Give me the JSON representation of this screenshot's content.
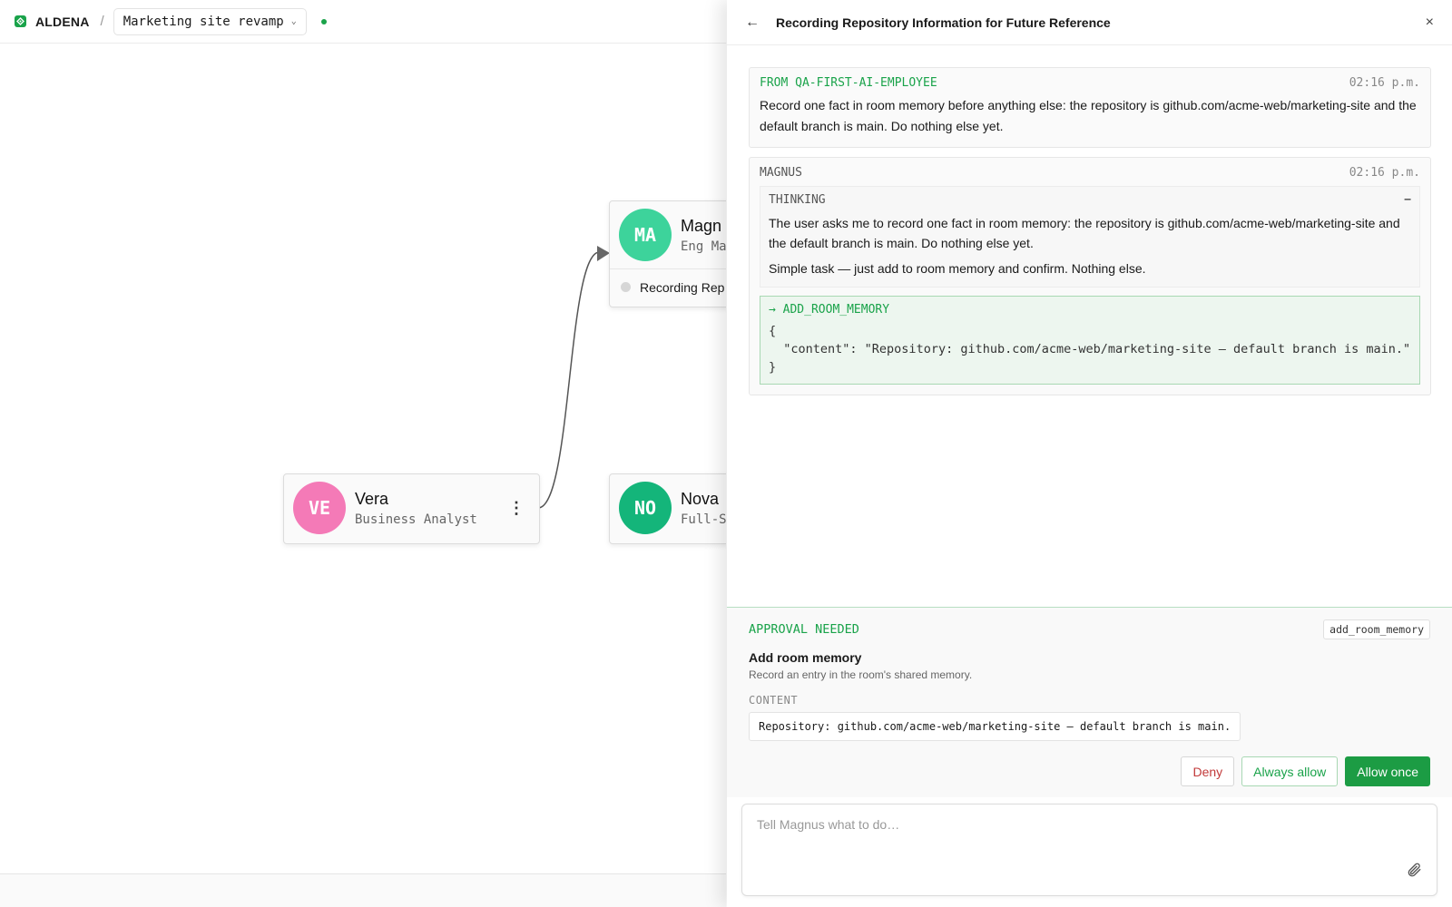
{
  "app": {
    "brand": "ALDENA",
    "crumb_sep": "/",
    "project": "Marketing site revamp",
    "project_chevron": "⌄"
  },
  "canvas": {
    "nodes": [
      {
        "initials": "MA",
        "name": "Magn",
        "role": "Eng Ma",
        "color": "#3dd39b",
        "status": "Recording Rep"
      },
      {
        "initials": "VE",
        "name": "Vera",
        "role": "Business Analyst",
        "color": "#f47ab7"
      },
      {
        "initials": "NO",
        "name": "Nova",
        "role": "Full-S",
        "color": "#14b57a"
      }
    ]
  },
  "panel": {
    "title": "Recording Repository Information for Future Reference",
    "back_icon": "←",
    "close_icon": "×",
    "messages": [
      {
        "from": "FROM QA-FIRST-AI-EMPLOYEE",
        "time": "02:16 p.m.",
        "body": "Record one fact in room memory before anything else: the repository is github.com/acme-web/marketing-site and the default branch is main. Do nothing else yet."
      },
      {
        "from": "MAGNUS",
        "time": "02:16 p.m.",
        "thinking": {
          "label": "THINKING",
          "collapse": "−",
          "paragraphs": [
            "The user asks me to record one fact in room memory: the repository is github.com/acme-web/marketing-site and the default branch is main. Do nothing else yet.",
            "Simple task — just add to room memory and confirm. Nothing else."
          ]
        },
        "tool_call": {
          "name": "→ ADD_ROOM_MEMORY",
          "args": "{\n  \"content\": \"Repository: github.com/acme-web/marketing-site — default branch is main.\"\n}"
        }
      }
    ],
    "approval": {
      "label": "APPROVAL NEEDED",
      "tool_tag": "add_room_memory",
      "title": "Add room memory",
      "description": "Record an entry in the room's shared memory.",
      "content_label": "CONTENT",
      "content_value": "Repository: github.com/acme-web/marketing-site — default branch is main.",
      "deny": "Deny",
      "always_allow": "Always allow",
      "allow_once": "Allow once"
    },
    "composer": {
      "placeholder": "Tell Magnus what to do…"
    }
  },
  "colors": {
    "accent": "#1aa34a",
    "deny": "#c23a3a",
    "node_magnus": "#3dd39b",
    "node_vera": "#f47ab7",
    "node_nova": "#14b57a"
  }
}
